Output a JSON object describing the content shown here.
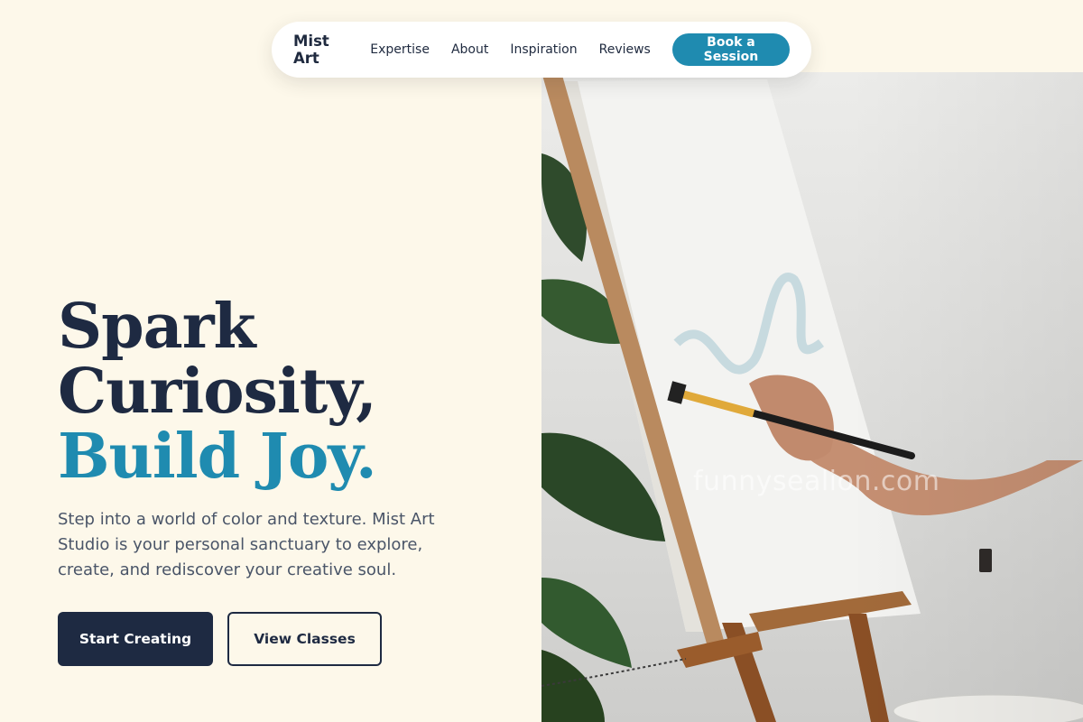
{
  "nav": {
    "brand": "Mist Art",
    "links": [
      "Expertise",
      "About",
      "Inspiration",
      "Reviews"
    ],
    "cta": "Book a Session"
  },
  "hero": {
    "headline_line1": "Spark",
    "headline_line2": "Curiosity,",
    "headline_line3": "Build Joy.",
    "lead": "Step into a world of color and texture. Mist Art Studio is your personal sanctuary to explore, create, and rediscover your creative soul.",
    "primary_button": "Start Creating",
    "secondary_button": "View Classes",
    "image_watermark": "funnysealion.com"
  },
  "colors": {
    "background": "#fdf8ea",
    "navy": "#1e2a42",
    "accent": "#1f8bb0",
    "muted_text": "#4a5568"
  }
}
